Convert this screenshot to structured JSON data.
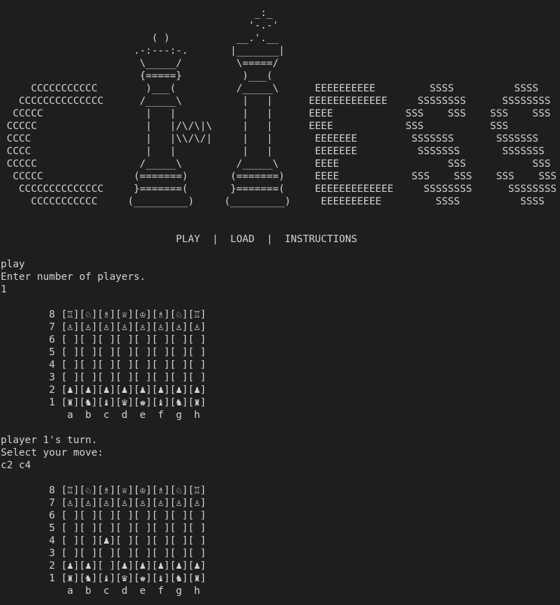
{
  "banner": {
    "logo_lines": [
      "                                          _:_",
      "                                         '-.-'",
      "                         ( )           __.'.__",
      "                      .-:---:-.       |_______|",
      "                       \\_____/         \\=====/",
      "                       {=====}          )___(",
      "     CCCCCCCCCCC        )___(          /_____\\      EEEEEEEEEE         SSSS          SSSS",
      "   CCCCCCCCCCCCCC      /_____\\          |   |      EEEEEEEEEEEEE     SSSSSSSS      SSSSSSSS",
      "  CCCCC                 |   |           |   |      EEEE            SSS    SSS    SSS    SSS",
      " CCCCC                  |   |/\\/\\|\\     |   |      EEEE            SSS           SSS",
      " CCCC                   |   |\\\\/\\/|     |   |       EEEEEEE         SSSSSSS       SSSSSSS",
      " CCCC                   |   |           |   |       EEEEEEE          SSSSSSS       SSSSSSS",
      " CCCCC                 /_____\\         /_____\\      EEEE                  SSS           SSS",
      "  CCCCC               (=======)       (=======)     EEEE            SSS    SSS    SSS    SSS",
      "   CCCCCCCCCCCCCC     }=======(       }=======(     EEEEEEEEEEEEE     SSSSSSSS      SSSSSSSS",
      "     CCCCCCCCCCC     (_________)     (_________)     EEEEEEEEEE         SSSS          SSSS"
    ],
    "menu": "                             PLAY  |  LOAD  |  INSTRUCTIONS"
  },
  "session": {
    "lines_before_board1": [
      "play",
      "Enter number of players.",
      "1"
    ],
    "board1": [
      "        8 [♖][♘][♗][♕][♔][♗][♘][♖]",
      "        7 [♙][♙][♙][♙][♙][♙][♙][♙]",
      "        6 [ ][ ][ ][ ][ ][ ][ ][ ]",
      "        5 [ ][ ][ ][ ][ ][ ][ ][ ]",
      "        4 [ ][ ][ ][ ][ ][ ][ ][ ]",
      "        3 [ ][ ][ ][ ][ ][ ][ ][ ]",
      "        2 [♟][♟][♟][♟][♟][♟][♟][♟]",
      "        1 [♜][♞][♝][♛][♚][♝][♞][♜]",
      "           a  b  c  d  e  f  g  h"
    ],
    "lines_between": [
      "player 1's turn.",
      "Select your move:",
      "c2 c4"
    ],
    "board2": [
      "        8 [♖][♘][♗][♕][♔][♗][♘][♖]",
      "        7 [♙][♙][♙][♙][♙][♙][♙][♙]",
      "        6 [ ][ ][ ][ ][ ][ ][ ][ ]",
      "        5 [ ][ ][ ][ ][ ][ ][ ][ ]",
      "        4 [ ][ ][♟][ ][ ][ ][ ][ ]",
      "        3 [ ][ ][ ][ ][ ][ ][ ][ ]",
      "        2 [♟][♟][ ][♟][♟][♟][♟][♟]",
      "        1 [♜][♞][♝][♛][♚][♝][♞][♜]",
      "           a  b  c  d  e  f  g  h"
    ]
  }
}
